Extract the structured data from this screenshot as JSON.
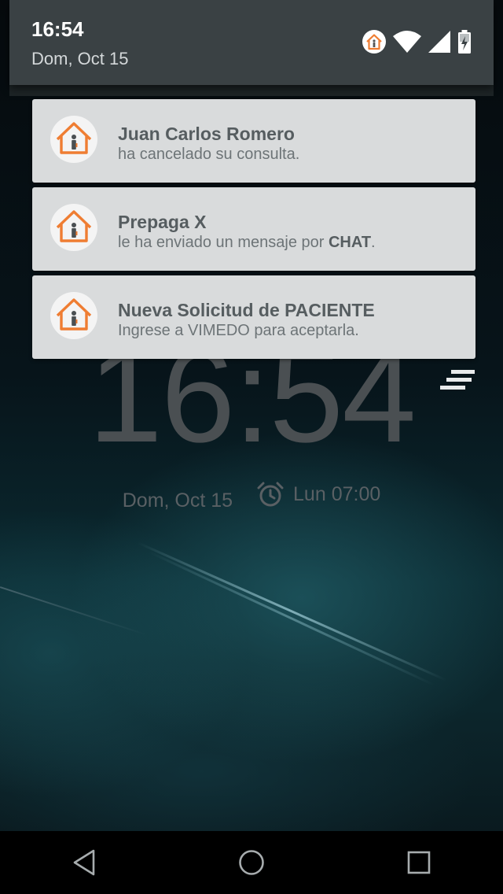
{
  "status_bar": {
    "time": "16:54",
    "date": "Dom, Oct 15",
    "icons": [
      "vimedo-app-icon",
      "wifi-icon",
      "cell-signal-icon",
      "battery-charging-icon"
    ]
  },
  "notifications": [
    {
      "app_icon": "vimedo-house-icon",
      "title": "Juan Carlos Romero",
      "body": "ha cancelado su consulta."
    },
    {
      "app_icon": "vimedo-house-icon",
      "title": "Prepaga X",
      "body_prefix": "le  ha enviado un mensaje por ",
      "body_bold": "CHAT",
      "body_suffix": "."
    },
    {
      "app_icon": "vimedo-house-icon",
      "title": "Nueva Solicitud de PACIENTE",
      "body": "Ingrese a VIMEDO para aceptarla."
    }
  ],
  "lockscreen": {
    "clock": "16:54",
    "date": "Dom, Oct 15",
    "alarm_icon": "alarm-clock-icon",
    "alarm": "Lun 07:00"
  },
  "nav_bar": {
    "buttons": [
      "back-icon",
      "home-icon",
      "recents-icon"
    ]
  },
  "colors": {
    "accent": "#ef7d32",
    "card_background": "#d9dbdc",
    "status_bar": "#3a4144"
  }
}
